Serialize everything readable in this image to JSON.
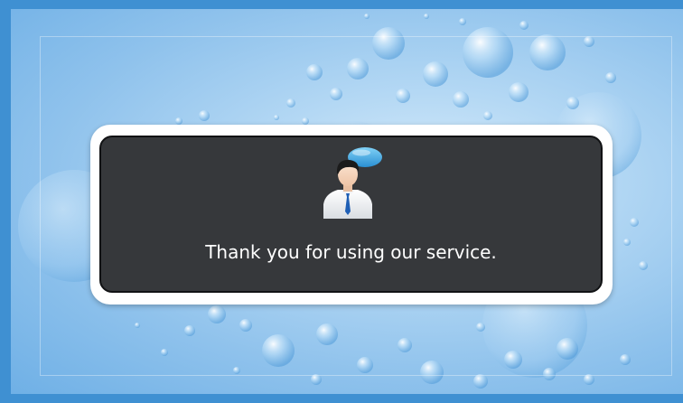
{
  "screen": {
    "message": "Thank you for using our service.",
    "icon": "customer-service-person-icon",
    "background_color": "#9cc9f0",
    "dialog_color": "#36383b",
    "border_color": "#3f90d2"
  }
}
